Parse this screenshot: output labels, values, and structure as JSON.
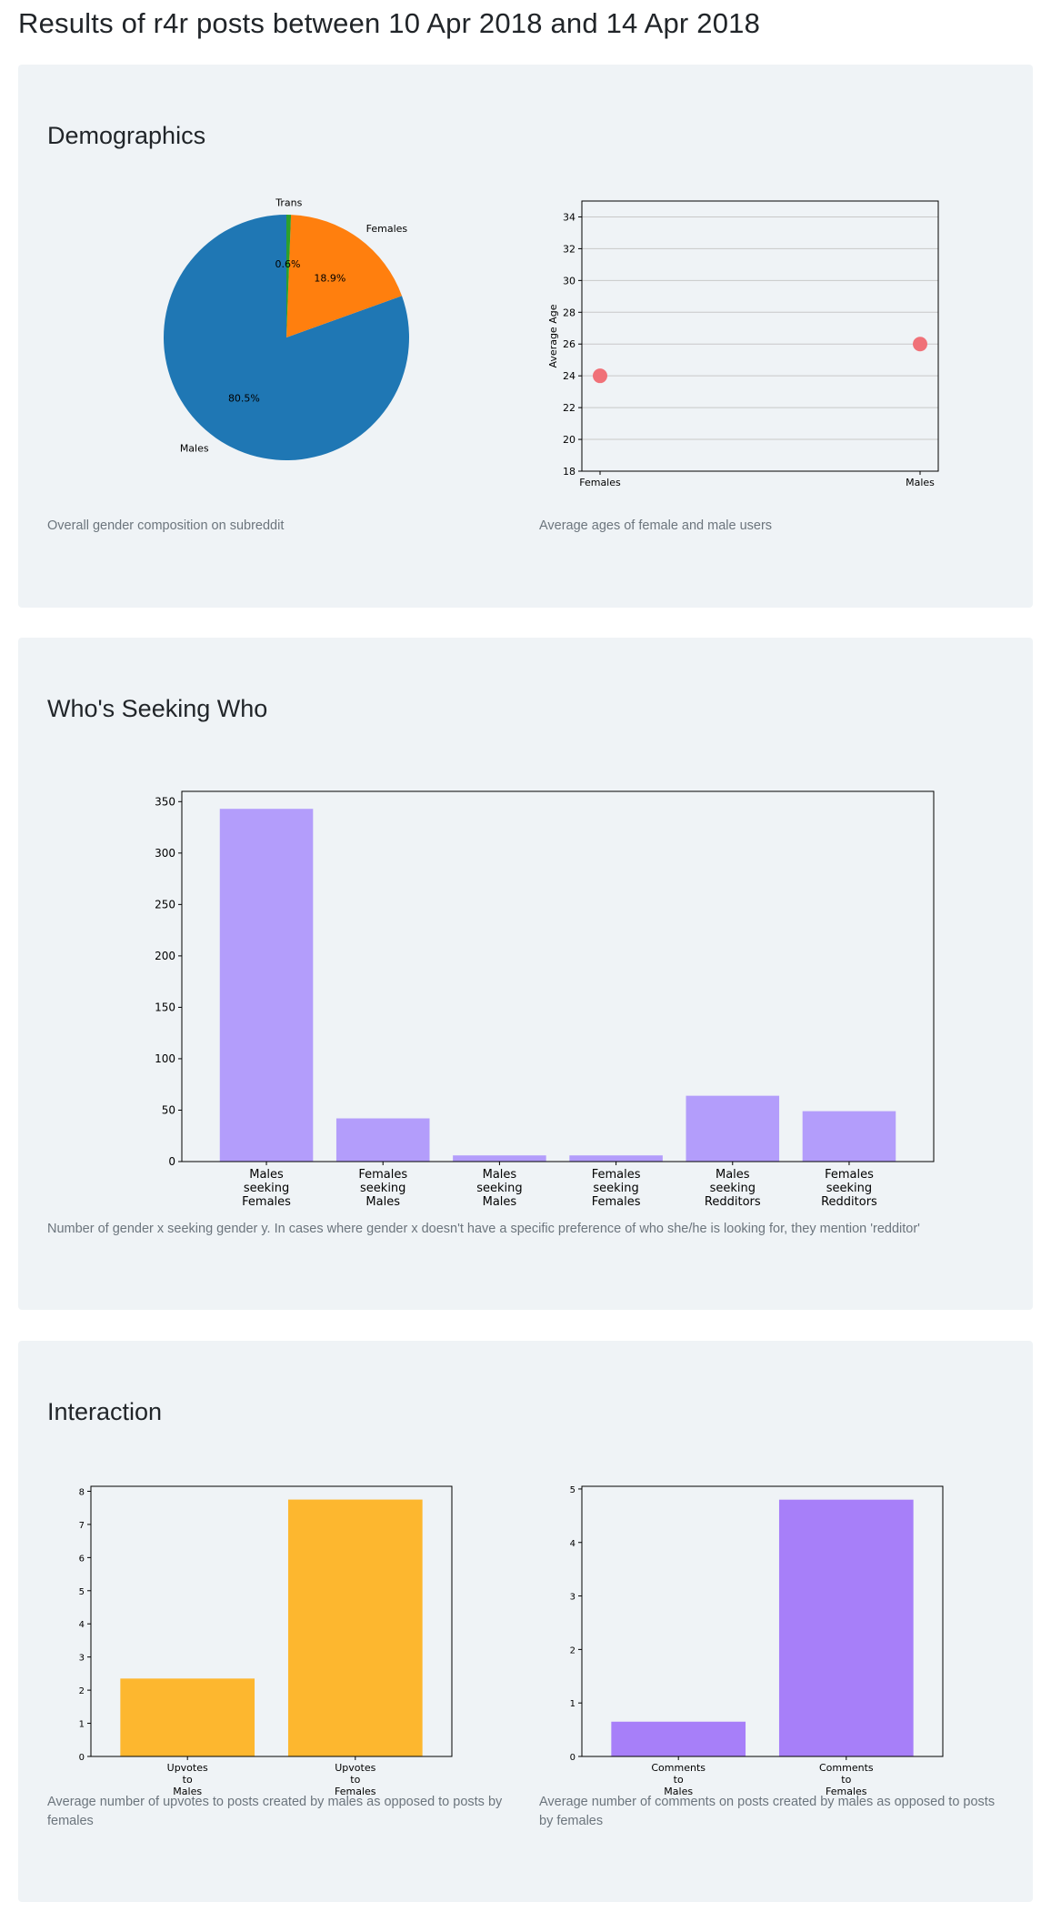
{
  "page": {
    "title": "Results of r4r posts between 10 Apr 2018 and 14 Apr 2018"
  },
  "sections": {
    "demographics": {
      "title": "Demographics",
      "gender_caption": "Overall gender composition on subreddit",
      "age_caption": "Average ages of female and male users"
    },
    "seeking": {
      "title": "Who's Seeking Who",
      "caption": "Number of gender x seeking gender y. In cases where gender x doesn't have a specific preference of who she/he is looking for, they mention 'redditor'"
    },
    "interaction": {
      "title": "Interaction",
      "upvotes_caption": "Average number of upvotes to posts created by males as opposed to posts by females",
      "comments_caption": "Average number of comments on posts created by males as opposed to posts by females"
    }
  },
  "chart_data": [
    {
      "id": "gender",
      "type": "pie",
      "categories": [
        "Males",
        "Females",
        "Trans"
      ],
      "values": [
        80.5,
        18.9,
        0.6
      ],
      "value_labels": [
        "80.5%",
        "18.9%",
        "0.6%"
      ],
      "colors": [
        "#1f77b4",
        "#ff7f0e",
        "#2ca02c"
      ]
    },
    {
      "id": "age",
      "type": "scatter",
      "categories": [
        "Females",
        "Males"
      ],
      "values": [
        24,
        26
      ],
      "ylabel": "Average Age",
      "ylim": [
        18,
        35
      ],
      "yticks": [
        18,
        20,
        22,
        24,
        26,
        28,
        30,
        32,
        34
      ],
      "grid": true,
      "color": "#f07178"
    },
    {
      "id": "seeking",
      "type": "bar",
      "categories": [
        "Males\nseeking\nFemales",
        "Females\nseeking\nMales",
        "Males\nseeking\nMales",
        "Females\nseeking\nFemales",
        "Males\nseeking\nRedditors",
        "Females\nseeking\nRedditors"
      ],
      "values": [
        343,
        42,
        6,
        6,
        64,
        49
      ],
      "ylim": [
        0,
        360
      ],
      "yticks": [
        0,
        50,
        100,
        150,
        200,
        250,
        300,
        350
      ],
      "color": "#b39dfb"
    },
    {
      "id": "upvotes",
      "type": "bar",
      "categories": [
        "Upvotes\nto\nMales",
        "Upvotes\nto\nFemales"
      ],
      "values": [
        2.35,
        7.75
      ],
      "ylim": [
        0,
        8.15
      ],
      "yticks": [
        0,
        1,
        2,
        3,
        4,
        5,
        6,
        7,
        8
      ],
      "color": "#fdb72f"
    },
    {
      "id": "comments",
      "type": "bar",
      "categories": [
        "Comments\nto\nMales",
        "Comments\nto\nFemales"
      ],
      "values": [
        0.65,
        4.8
      ],
      "ylim": [
        0,
        5.05
      ],
      "yticks": [
        0,
        1,
        2,
        3,
        4,
        5
      ],
      "color": "#a77ff9"
    }
  ]
}
